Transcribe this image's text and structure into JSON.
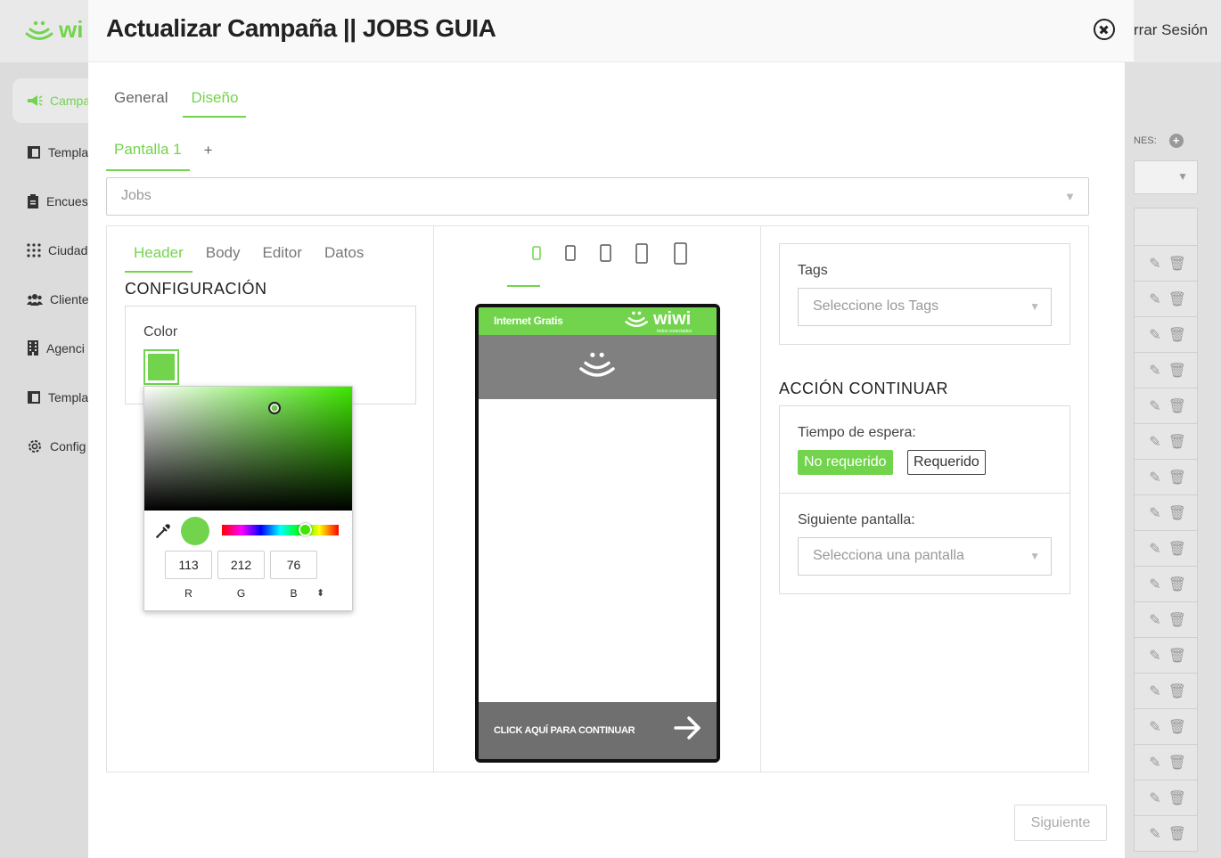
{
  "background": {
    "logo_text": "wi",
    "logout_label": "rrar Sesión",
    "nav": [
      {
        "label": "Campa",
        "icon": "megaphone-icon"
      },
      {
        "label": "Templa",
        "icon": "template-icon"
      },
      {
        "label": "Encues",
        "icon": "clipboard-icon"
      },
      {
        "label": "Ciudad",
        "icon": "grid-dots-icon"
      },
      {
        "label": "Cliente",
        "icon": "users-icon"
      },
      {
        "label": "Agenci",
        "icon": "building-icon"
      },
      {
        "label": "Templa",
        "icon": "template-icon"
      },
      {
        "label": "Config",
        "icon": "gear-icon"
      }
    ],
    "right_label": "NES:"
  },
  "modal": {
    "title": "Actualizar Campaña || JOBS GUIA",
    "tabs": [
      "General",
      "Diseño"
    ],
    "active_tab": "Diseño",
    "screens": {
      "items": [
        "Pantalla 1"
      ],
      "add_label": "+"
    },
    "screen_select_value": "Jobs",
    "section_tabs": [
      "Header",
      "Body",
      "Editor",
      "Datos"
    ],
    "config_title": "CONFIGURACIÓN",
    "color_label": "Color",
    "color_value": "#71d44c",
    "picker": {
      "r": "113",
      "g": "212",
      "b": "76",
      "labels": [
        "R",
        "G",
        "B"
      ],
      "toggle": "⬍"
    },
    "preview": {
      "bar_text": "Internet Gratis",
      "logo_text": "wiwi",
      "logo_sub": "todos conectados",
      "footer_text": "CLICK AQUÍ PARA CONTINUAR"
    },
    "tags": {
      "label": "Tags",
      "placeholder": "Seleccione los Tags"
    },
    "accion": {
      "title": "ACCIÓN CONTINUAR",
      "wait_label": "Tiempo de espera:",
      "btn_no_requerido": "No requerido",
      "btn_requerido": "Requerido",
      "next_label": "Siguiente pantalla:",
      "next_placeholder": "Selecciona una pantalla"
    },
    "siguiente_label": "Siguiente",
    "accent_color": "#72d44c"
  }
}
